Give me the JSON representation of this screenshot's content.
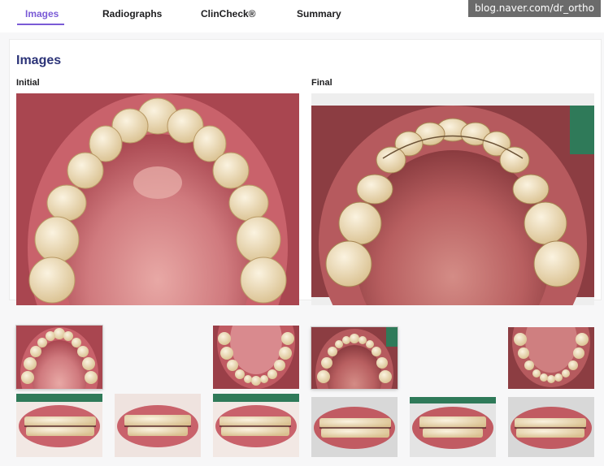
{
  "tabs": [
    {
      "label": "Images",
      "active": true
    },
    {
      "label": "Radiographs",
      "active": false
    },
    {
      "label": "ClinCheck®",
      "active": false
    },
    {
      "label": "Summary",
      "active": false
    }
  ],
  "watermark": "blog.naver.com/dr_ortho",
  "section": {
    "title": "Images",
    "initial_label": "Initial",
    "final_label": "Final"
  },
  "photos": {
    "initial_main": "upper-occlusal-initial",
    "final_main": "upper-occlusal-final",
    "initial_thumbs": [
      "upper-occlusal",
      "lower-occlusal",
      "right-buccal",
      "frontal",
      "left-buccal"
    ],
    "final_thumbs": [
      "upper-occlusal",
      "lower-occlusal",
      "right-buccal",
      "frontal",
      "left-buccal"
    ]
  },
  "colors": {
    "accent": "#7a5bd6",
    "title": "#2c3478",
    "gum": "#c9626b",
    "tooth": "#efe0c0",
    "palate": "#d98a8e"
  }
}
